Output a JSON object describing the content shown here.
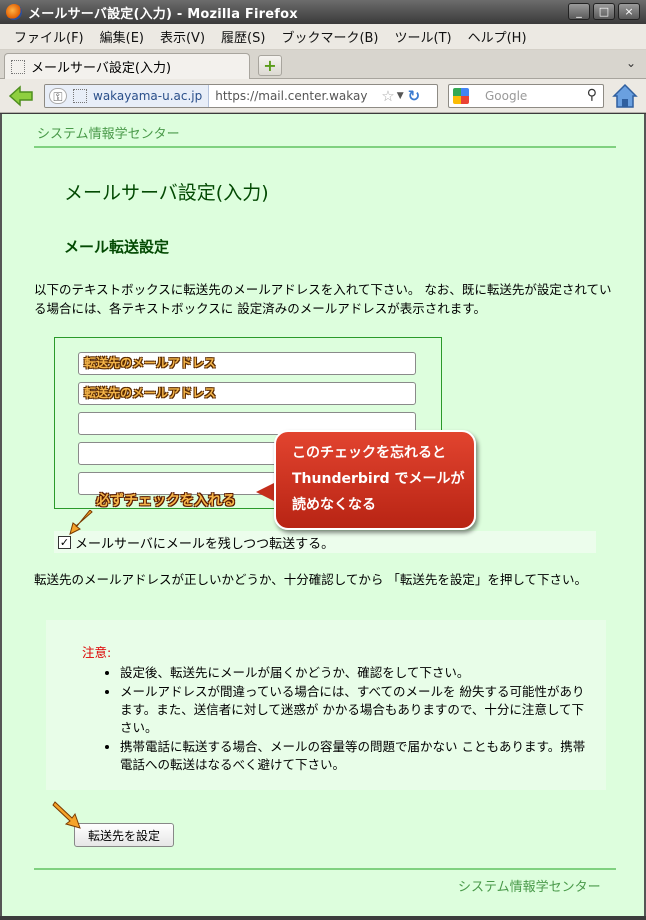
{
  "window": {
    "title": "メールサーバ設定(入力) - Mozilla Firefox"
  },
  "window_buttons": [
    "_",
    "□",
    "×"
  ],
  "menu": [
    "ファイル(F)",
    "編集(E)",
    "表示(V)",
    "履歴(S)",
    "ブックマーク(B)",
    "ツール(T)",
    "ヘルプ(H)"
  ],
  "tab": {
    "label": "メールサーバ設定(入力)",
    "newtab": "+",
    "list": "⌄"
  },
  "navbar": {
    "identity": "wakayama-u.ac.jp",
    "url": "https://mail.center.wakay",
    "search_placeholder": "Google"
  },
  "page": {
    "header_link": "システム情報学センター",
    "title": "メールサーバ設定(入力)",
    "section_title": "メール転送設定",
    "intro": "以下のテキストボックスに転送先のメールアドレスを入れて下さい。 なお、既に転送先が設定されている場合には、各テキストボックスに 設定済みのメールアドレスが表示されます。",
    "inputs": [
      {
        "value": "転送先のメールアドレス"
      },
      {
        "value": "転送先のメールアドレス"
      },
      {
        "value": ""
      },
      {
        "value": ""
      },
      {
        "value": ""
      }
    ],
    "keep_checkbox": {
      "checked": true,
      "mark": "✓",
      "label": "メールサーバにメールを残しつつ転送する。"
    },
    "confirm_text": "転送先のメールアドレスが正しいかどうか、十分確認してから 「転送先を設定」を押して下さい。",
    "notice": {
      "label": "注意:",
      "items": [
        "設定後、転送先にメールが届くかどうか、確認をして下さい。",
        "メールアドレスが間違っている場合には、すべてのメールを 紛失する可能性があります。また、送信者に対して迷惑が かかる場合もありますので、十分に注意して下さい。",
        "携帯電話に転送する場合、メールの容量等の問題で届かない こともあります。携帯電話への転送はなるべく避けて下さい。"
      ]
    },
    "submit_label": "転送先を設定",
    "footer_link": "システム情報学センター"
  },
  "annotations": {
    "callout_lines": [
      "このチェックを忘れると",
      "Thunderbird でメールが",
      "読めなくなる"
    ],
    "must_check": "必ずチェックを入れる"
  },
  "colors": {
    "page_bg": "#ddfedd",
    "heading": "#034a03",
    "rule": "#7fd17f",
    "notice_label": "#dd0000",
    "callout": "#c42e1c",
    "annotation_text": "#f5b64a"
  }
}
